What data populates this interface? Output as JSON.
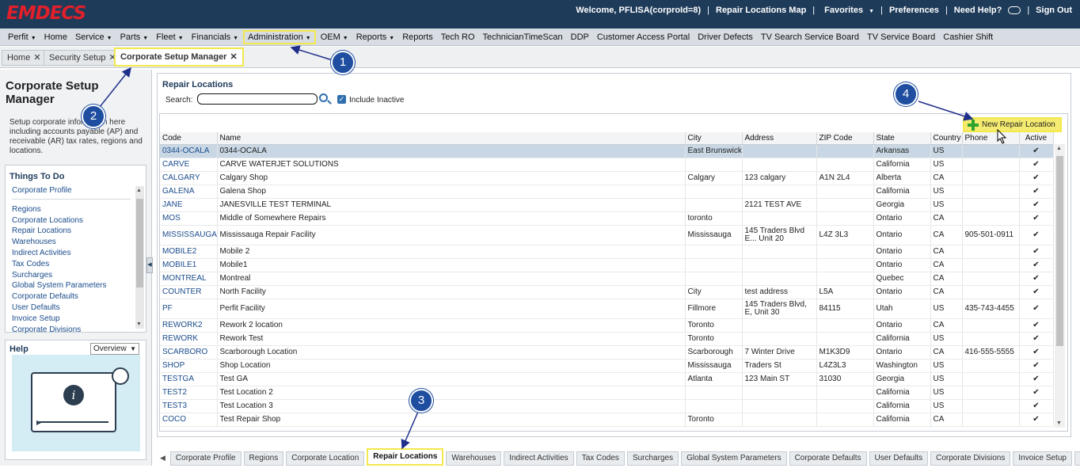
{
  "header": {
    "logo": "EMDECS",
    "welcome": "Welcome, PFLISA(corproId=8)",
    "repair_map": "Repair Locations Map",
    "favorites": "Favorites",
    "preferences": "Preferences",
    "help": "Need Help?",
    "signout": "Sign Out"
  },
  "menu": [
    {
      "label": "Perfit",
      "dropdown": true
    },
    {
      "label": "Home",
      "dropdown": false
    },
    {
      "label": "Service",
      "dropdown": true
    },
    {
      "label": "Parts",
      "dropdown": true
    },
    {
      "label": "Fleet",
      "dropdown": true
    },
    {
      "label": "Financials",
      "dropdown": true
    },
    {
      "label": "Administration",
      "dropdown": true
    },
    {
      "label": "OEM",
      "dropdown": true
    },
    {
      "label": "Reports",
      "dropdown": true
    },
    {
      "label": "Reports",
      "dropdown": false
    },
    {
      "label": "Tech RO",
      "dropdown": false
    },
    {
      "label": "TechnicianTimeScan",
      "dropdown": false
    },
    {
      "label": "DDP",
      "dropdown": false
    },
    {
      "label": "Customer Access Portal",
      "dropdown": false
    },
    {
      "label": "Driver Defects",
      "dropdown": false
    },
    {
      "label": "TV Search Service Board",
      "dropdown": false
    },
    {
      "label": "TV Service Board",
      "dropdown": false
    },
    {
      "label": "Cashier Shift",
      "dropdown": false
    }
  ],
  "tabs": [
    {
      "label": "Home"
    },
    {
      "label": "Security Setup"
    },
    {
      "label": "Corporate Setup Manager"
    }
  ],
  "left": {
    "title": "Corporate Setup Manager",
    "description": "Setup corporate information here including accounts payable (AP) and receivable (AR) tax rates, regions and locations.",
    "todo_title": "Things To Do",
    "todo_items": [
      "Corporate Profile",
      "Regions",
      "Corporate Locations",
      "Repair Locations",
      "Warehouses",
      "Indirect Activities",
      "Tax Codes",
      "Surcharges",
      "Global System Parameters",
      "Corporate Defaults",
      "User Defaults",
      "Invoice Setup",
      "Corporate Divisions"
    ],
    "help_title": "Help",
    "help_select": "Overview"
  },
  "main": {
    "title": "Repair Locations",
    "search_label": "Search:",
    "include_inactive": "Include Inactive",
    "new_button": "New Repair Location",
    "columns": [
      "Code",
      "Name",
      "City",
      "Address",
      "ZIP Code",
      "State",
      "Country",
      "Phone",
      "Active"
    ],
    "rows": [
      [
        "0344-OCALA",
        "0344-OCALA",
        "East Brunswick",
        "",
        "",
        "Arkansas",
        "US",
        "",
        "✔"
      ],
      [
        "CARVE",
        "CARVE WATERJET SOLUTIONS",
        "",
        "",
        "",
        "California",
        "US",
        "",
        "✔"
      ],
      [
        "CALGARY",
        "Calgary Shop",
        "Calgary",
        "123 calgary",
        "A1N 2L4",
        "Alberta",
        "CA",
        "",
        "✔"
      ],
      [
        "GALENA",
        "Galena Shop",
        "",
        "",
        "",
        "California",
        "US",
        "",
        "✔"
      ],
      [
        "JANE",
        "JANESVILLE TEST TERMINAL",
        "",
        "2121 TEST AVE",
        "",
        "Georgia",
        "US",
        "",
        "✔"
      ],
      [
        "MOS",
        "Middle of Somewhere Repairs",
        "toronto",
        "",
        "",
        "Ontario",
        "CA",
        "",
        "✔"
      ],
      [
        "MISSISSAUGA",
        "Mississauga Repair Facility",
        "Mississauga",
        "145 Traders Blvd E... Unit 20",
        "L4Z 3L3",
        "Ontario",
        "CA",
        "905-501-0911",
        "✔"
      ],
      [
        "MOBILE2",
        "Mobile 2",
        "",
        "",
        "",
        "Ontario",
        "CA",
        "",
        "✔"
      ],
      [
        "MOBILE1",
        "Mobile1",
        "",
        "",
        "",
        "Ontario",
        "CA",
        "",
        "✔"
      ],
      [
        "MONTREAL",
        "Montreal",
        "",
        "",
        "",
        "Quebec",
        "CA",
        "",
        "✔"
      ],
      [
        "COUNTER",
        "North Facility",
        "City",
        "test address",
        "L5A",
        "Ontario",
        "CA",
        "",
        "✔"
      ],
      [
        "PF",
        "Perfit Facility",
        "Fillmore",
        "145 Traders Blvd, E, Unit 30",
        "84115",
        "Utah",
        "US",
        "435-743-4455",
        "✔"
      ],
      [
        "REWORK2",
        "Rework 2 location",
        "Toronto",
        "",
        "",
        "Ontario",
        "CA",
        "",
        "✔"
      ],
      [
        "REWORK",
        "Rework Test",
        "Toronto",
        "",
        "",
        "California",
        "US",
        "",
        "✔"
      ],
      [
        "SCARBORO",
        "Scarborough Location",
        "Scarborough",
        "7 Winter Drive",
        "M1K3D9",
        "Ontario",
        "CA",
        "416-555-5555",
        "✔"
      ],
      [
        "SHOP",
        "Shop Location",
        "Mississauga",
        "Traders St",
        "L4Z3L3",
        "Washington",
        "US",
        "",
        "✔"
      ],
      [
        "TESTGA",
        "Test GA",
        "Atlanta",
        "123 Main ST",
        "31030",
        "Georgia",
        "US",
        "",
        "✔"
      ],
      [
        "TEST2",
        "Test Location 2",
        "",
        "",
        "",
        "California",
        "US",
        "",
        "✔"
      ],
      [
        "TEST3",
        "Test Location 3",
        "",
        "",
        "",
        "California",
        "US",
        "",
        "✔"
      ],
      [
        "COCO",
        "Test Repair Shop",
        "Toronto",
        "",
        "",
        "California",
        "CA",
        "",
        "✔"
      ]
    ]
  },
  "bottom_tabs": [
    "Corporate Profile",
    "Regions",
    "Corporate Location",
    "Repair Locations",
    "Warehouses",
    "Indirect Activities",
    "Tax Codes",
    "Surcharges",
    "Global System Parameters",
    "Corporate Defaults",
    "User Defaults",
    "Corporate Divisions",
    "Invoice Setup",
    "Mc"
  ],
  "callouts": [
    "1",
    "2",
    "3",
    "4"
  ],
  "colors": {
    "header": "#1e3b5a",
    "logo": "#e0202a",
    "highlight": "#f3e84c",
    "callout": "#1f4ea0",
    "link": "#1a4c8c"
  }
}
